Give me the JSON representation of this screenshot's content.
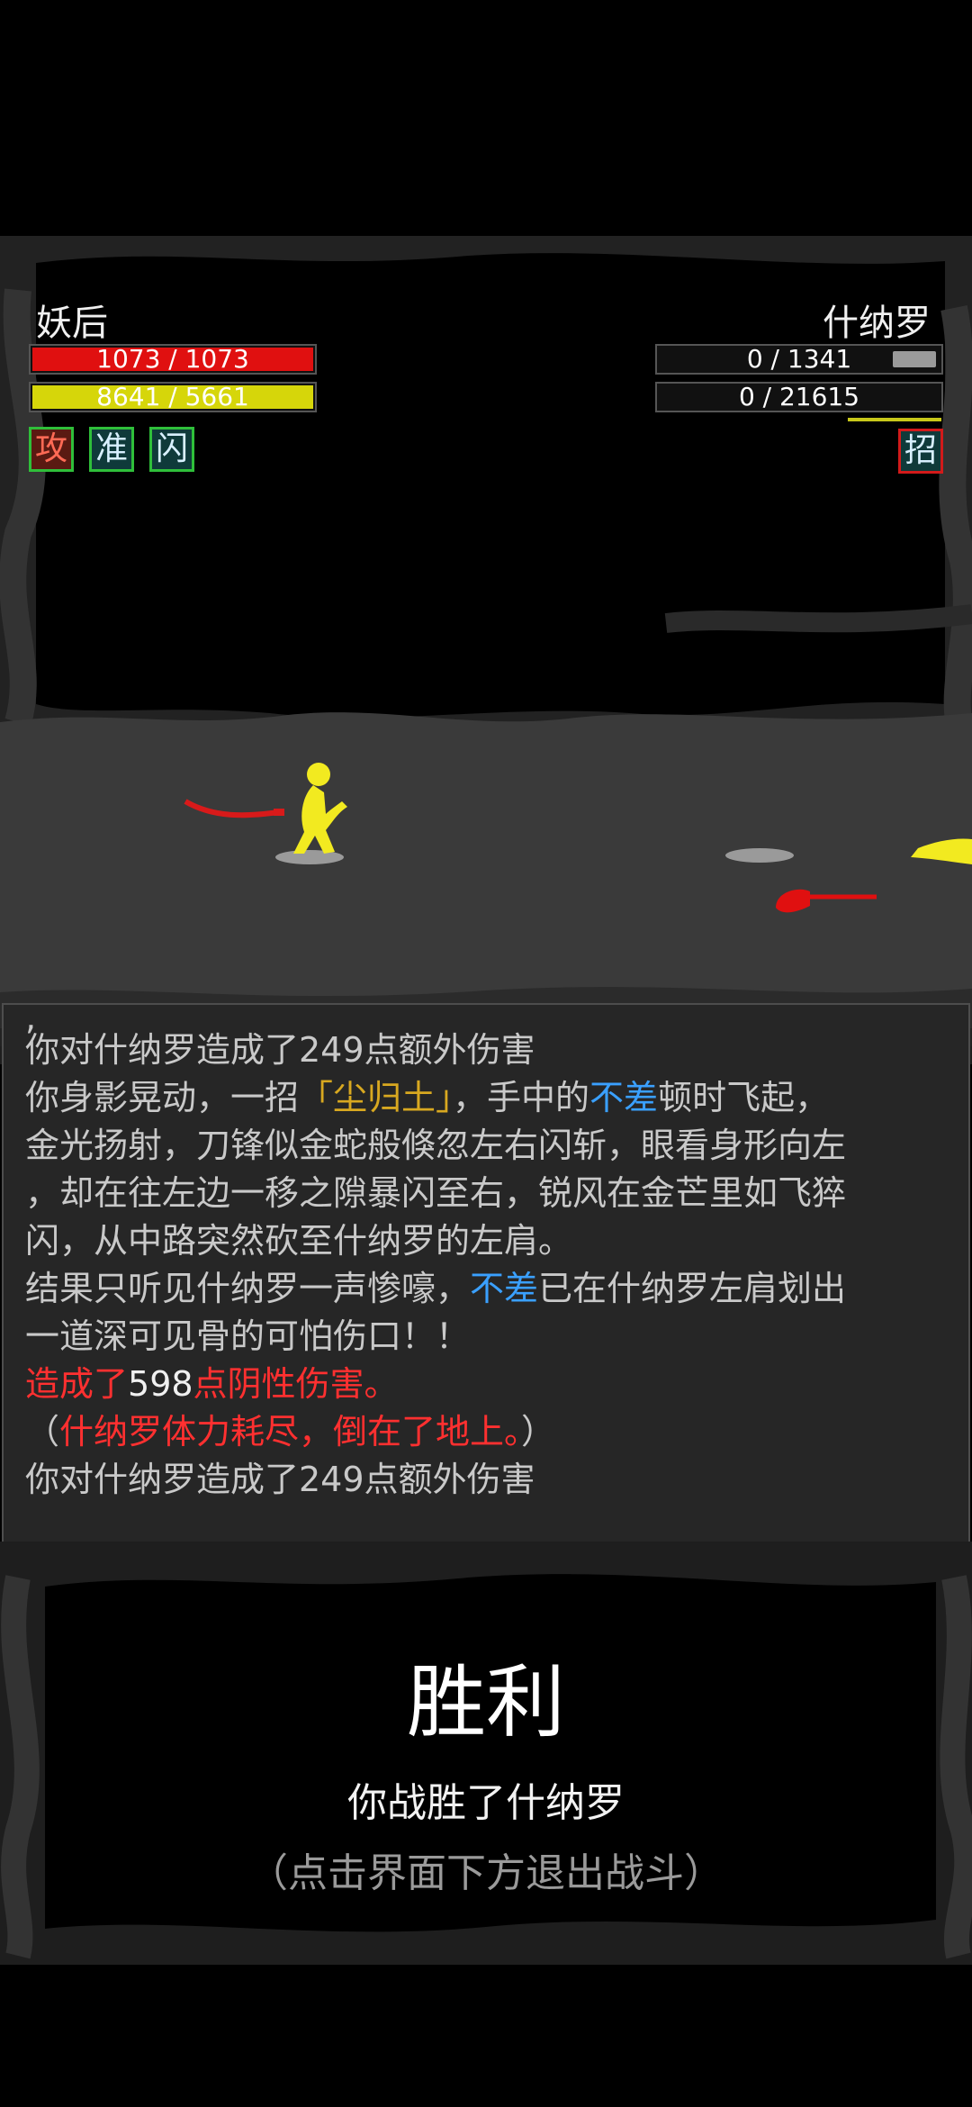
{
  "player": {
    "name": "妖后",
    "hp_text": "1073 / 1073",
    "hp_fraction": 1.0,
    "qi_text": "8641 / 5661",
    "qi_fraction": 1.0,
    "skills": [
      "攻",
      "准",
      "闪"
    ]
  },
  "enemy": {
    "name": "什纳罗",
    "hp_text": "0 / 1341",
    "hp_fraction": 0,
    "qi_text": "0 / 21615",
    "qi_fraction": 0,
    "skills": [
      "招"
    ]
  },
  "log": {
    "top_mark": ",",
    "line1": "你对什纳罗造成了249点额外伤害",
    "line2_a": "你身影晃动，一招",
    "line2_skill": "「尘归土」",
    "line2_b": "，手中的",
    "line2_weapon": "不差",
    "line2_c": "顿时飞起，",
    "line3": "金光扬射，刀锋似金蛇般倏忽左右闪斩，眼看身形向左",
    "line4": "，却在往左边一移之隙暴闪至右，锐风在金芒里如飞猝",
    "line5": "闪，从中路突然砍至什纳罗的左肩。",
    "line6_a": "结果只听见什纳罗一声惨嚎，",
    "line6_weapon": "不差",
    "line6_b": "已在什纳罗左肩划出",
    "line7": "一道深可见骨的可怕伤口！！",
    "line8_a": "造成了",
    "line8_num": "598",
    "line8_b": "点阴性伤害。",
    "line9_open": "（",
    "line9_text": "什纳罗体力耗尽，倒在了地上。",
    "line9_close": "）",
    "line10": "你对什纳罗造成了249点额外伤害"
  },
  "result": {
    "title": "胜利",
    "subtitle": "你战胜了什纳罗",
    "hint": "（点击界面下方退出战斗）"
  },
  "colors": {
    "hp_red": "#e01010",
    "qi_yellow": "#d6d60a",
    "damage_red": "#ff3030",
    "weapon_blue": "#3aa0ff",
    "skill_gold": "#d8a820"
  }
}
